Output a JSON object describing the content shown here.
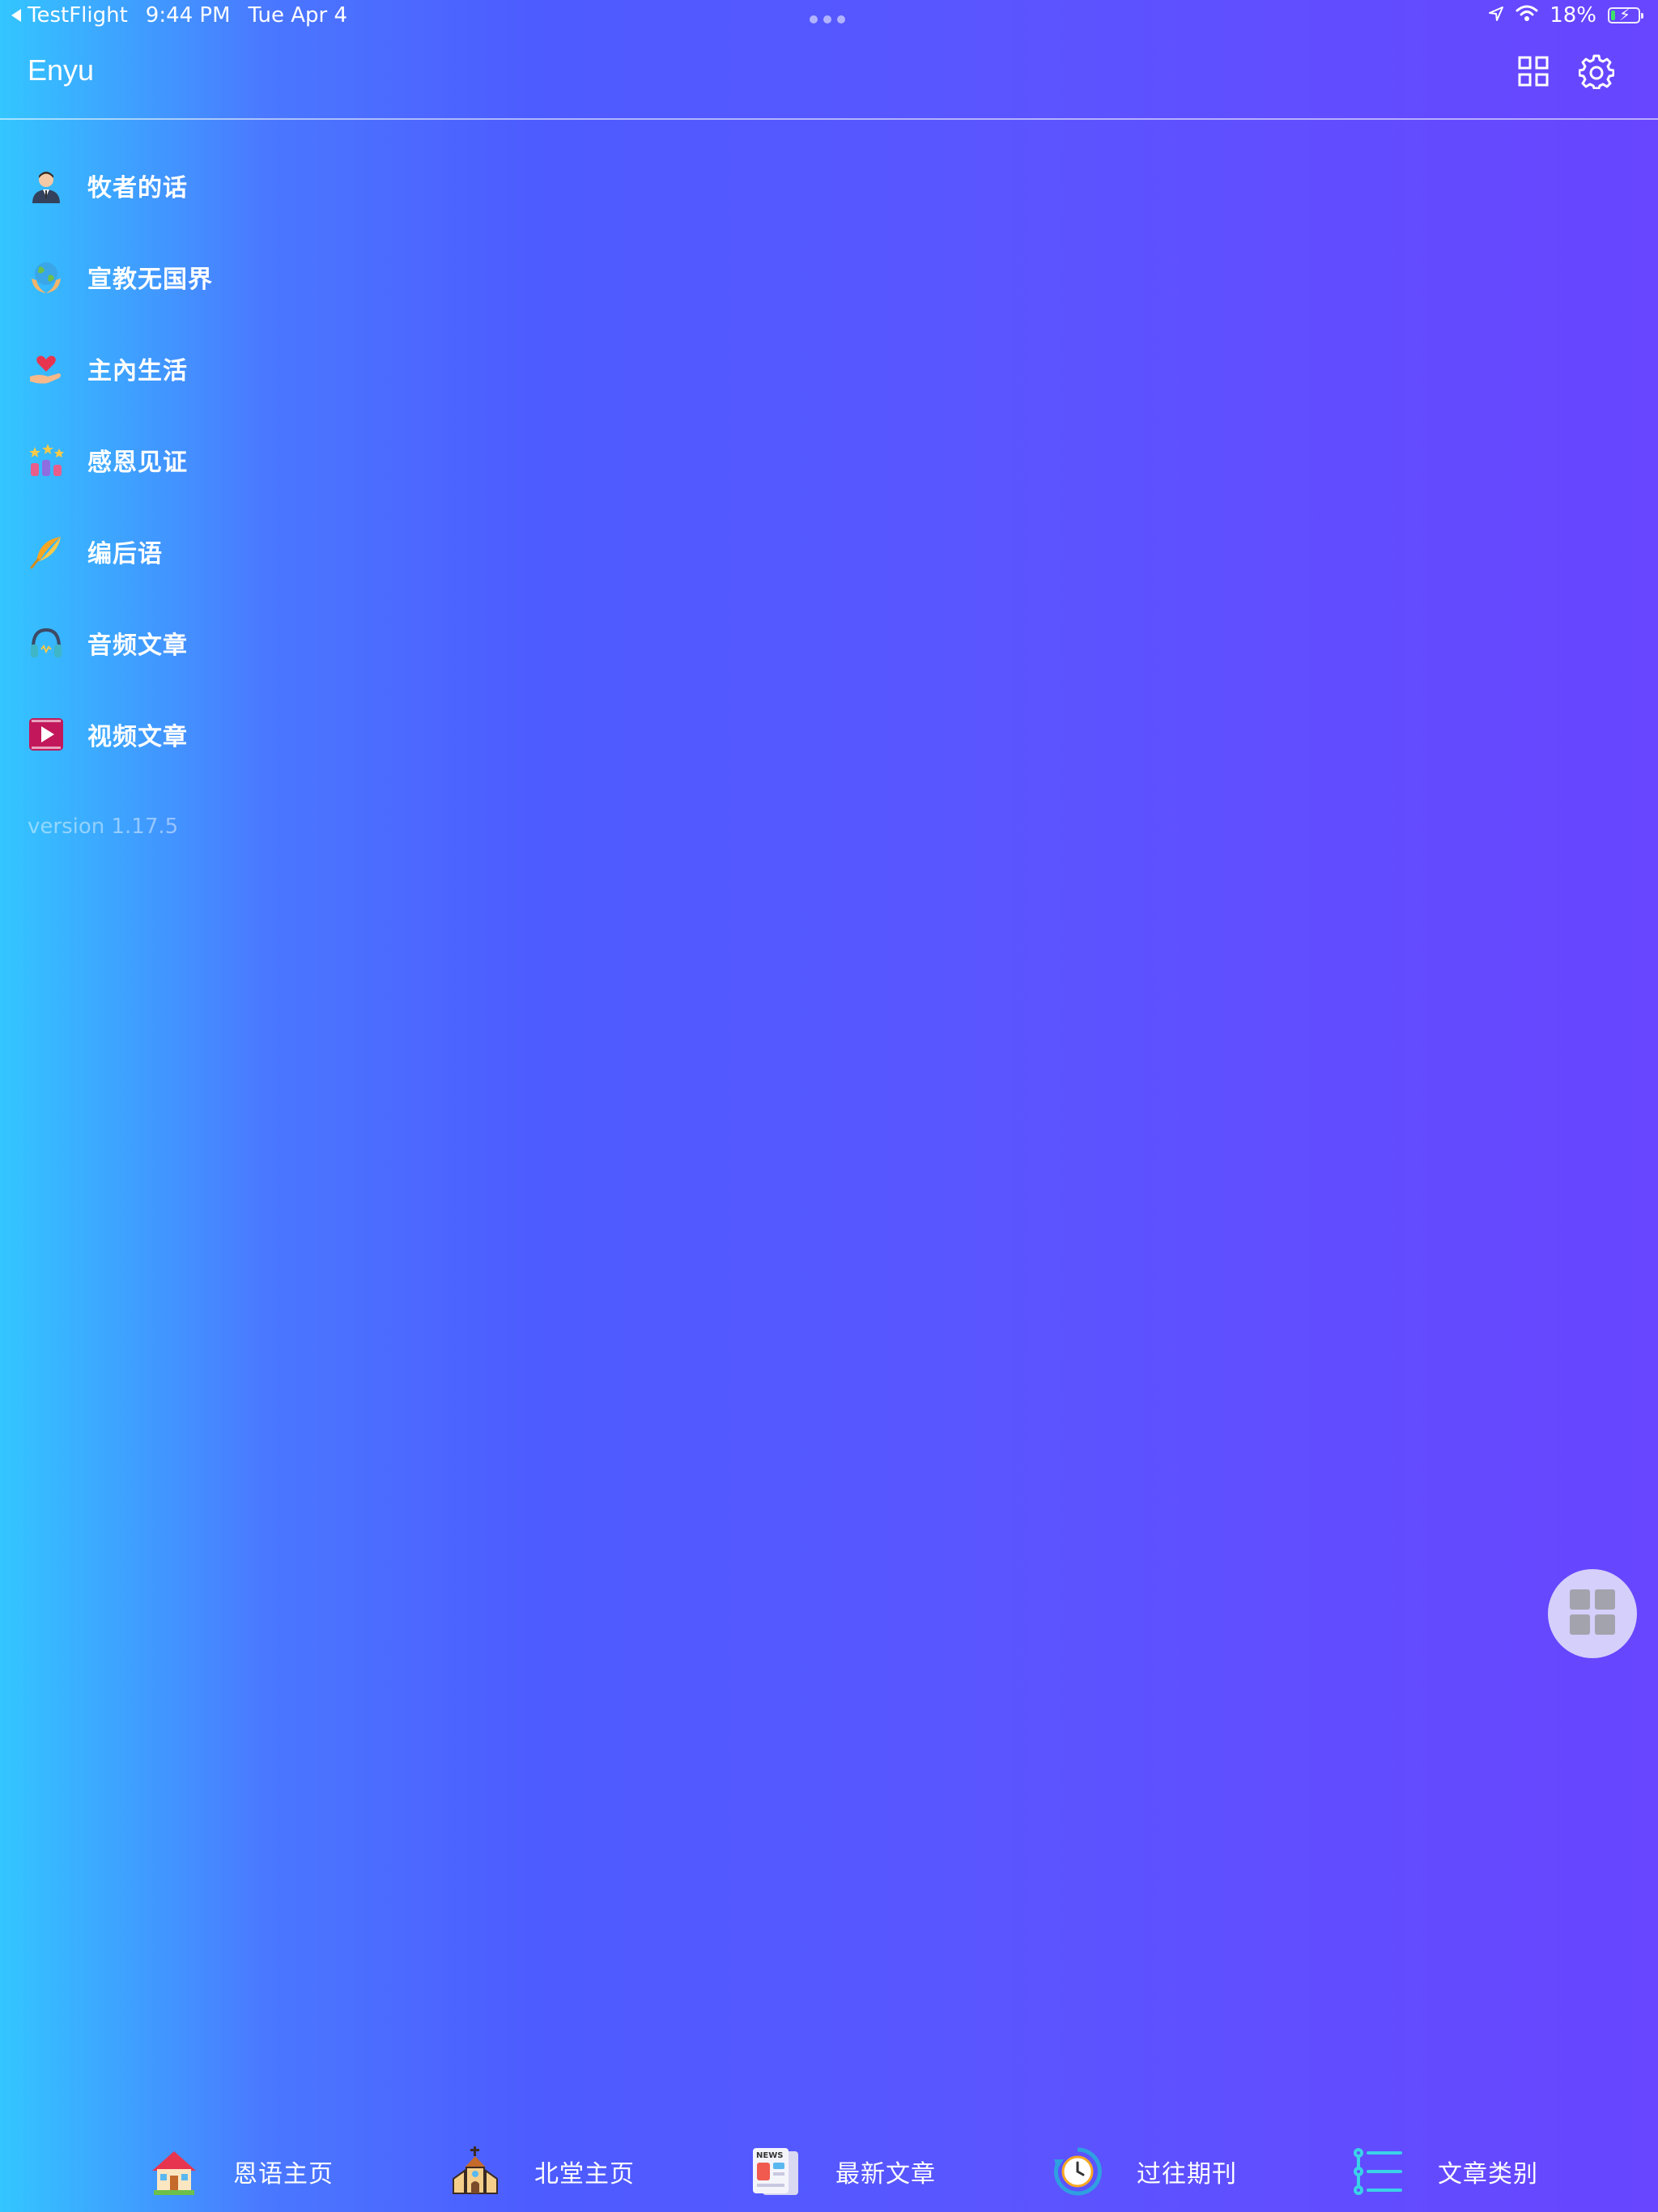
{
  "status_bar": {
    "back_app": "TestFlight",
    "time": "9:44 PM",
    "date": "Tue Apr 4",
    "battery": "18%",
    "battery_level": 0.18
  },
  "header": {
    "title": "Enyu",
    "icons": [
      "grid-icon",
      "gear-icon"
    ]
  },
  "menu": {
    "items": [
      {
        "label": "牧者的话",
        "icon": "pastor-icon"
      },
      {
        "label": "宣教无国界",
        "icon": "globe-hands-icon"
      },
      {
        "label": "主內生活",
        "icon": "heart-hand-icon"
      },
      {
        "label": "感恩见证",
        "icon": "stars-people-icon"
      },
      {
        "label": "编后语",
        "icon": "feather-icon"
      },
      {
        "label": "音频文章",
        "icon": "headphones-icon"
      },
      {
        "label": "视频文章",
        "icon": "video-play-icon"
      }
    ],
    "version": "version 1.17.5"
  },
  "tabs": [
    {
      "label": "恩语主页",
      "icon": "house-icon"
    },
    {
      "label": "北堂主页",
      "icon": "church-icon"
    },
    {
      "label": "最新文章",
      "icon": "news-icon"
    },
    {
      "label": "过往期刊",
      "icon": "history-clock-icon"
    },
    {
      "label": "文章类别",
      "icon": "list-icon"
    }
  ],
  "colors": {
    "gradient_start": "#33c6ff",
    "gradient_mid": "#4d5cff",
    "gradient_end": "#6845ff",
    "battery_green": "#3ee06b"
  }
}
